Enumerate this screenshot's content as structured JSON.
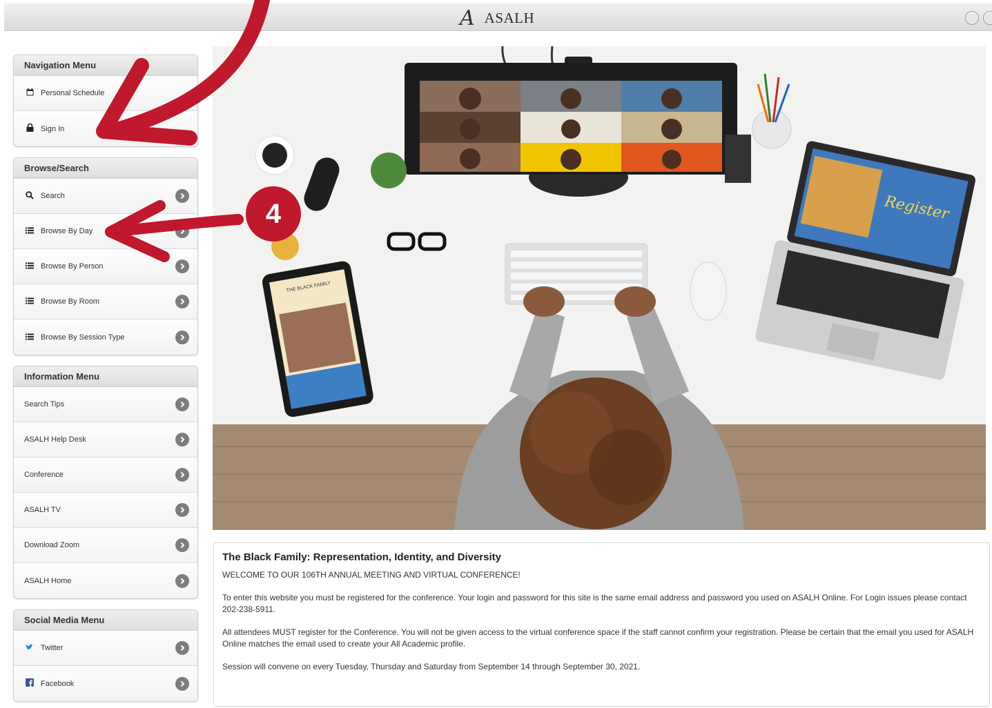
{
  "header": {
    "brand_mark": "A",
    "brand": "ASALH"
  },
  "sidebar": {
    "navigation": {
      "title": "Navigation Menu",
      "items": [
        {
          "label": "Personal Schedule",
          "icon": "calendar-icon"
        },
        {
          "label": "Sign In",
          "icon": "lock-icon"
        }
      ]
    },
    "browse": {
      "title": "Browse/Search",
      "items": [
        {
          "label": "Search",
          "icon": "search-icon"
        },
        {
          "label": "Browse By Day",
          "icon": "list-icon"
        },
        {
          "label": "Browse By Person",
          "icon": "list-icon"
        },
        {
          "label": "Browse By Room",
          "icon": "list-icon"
        },
        {
          "label": "Browse By Session Type",
          "icon": "list-icon"
        }
      ]
    },
    "information": {
      "title": "Information Menu",
      "items": [
        {
          "label": "Search Tips"
        },
        {
          "label": "ASALH Help Desk"
        },
        {
          "label": "Conference"
        },
        {
          "label": "ASALH TV"
        },
        {
          "label": "Download Zoom"
        },
        {
          "label": "ASALH Home"
        }
      ]
    },
    "social": {
      "title": "Social Media Menu",
      "items": [
        {
          "label": "Twitter",
          "icon": "twitter-icon"
        },
        {
          "label": "Facebook",
          "icon": "facebook-icon"
        }
      ]
    }
  },
  "hero": {
    "laptop_text": "Register",
    "tablet_text": "THE BLACK FAMILY"
  },
  "content": {
    "title": "The Black Family: Representation, Identity, and Diversity",
    "welcome": "WELCOME TO OUR 106TH ANNUAL MEETING AND VIRTUAL CONFERENCE!",
    "para1": "To enter this website you must be registered for the conference. Your login and password for this site is the same email address and password you used on ASALH Online. For Login issues please contact 202-238-5911.",
    "para2": "All attendees MUST register for the Conference. You will not be given access to the virtual conference space if the staff cannot confirm your registration. Please be certain that the email you used for ASALH Online matches the email used to create your All Academic profile.",
    "para3": "Session will convene on every Tuesday, Thursday and Saturday from September 14 through September 30, 2021."
  },
  "annotation": {
    "step_badge": "4",
    "color": "#c0182c"
  }
}
